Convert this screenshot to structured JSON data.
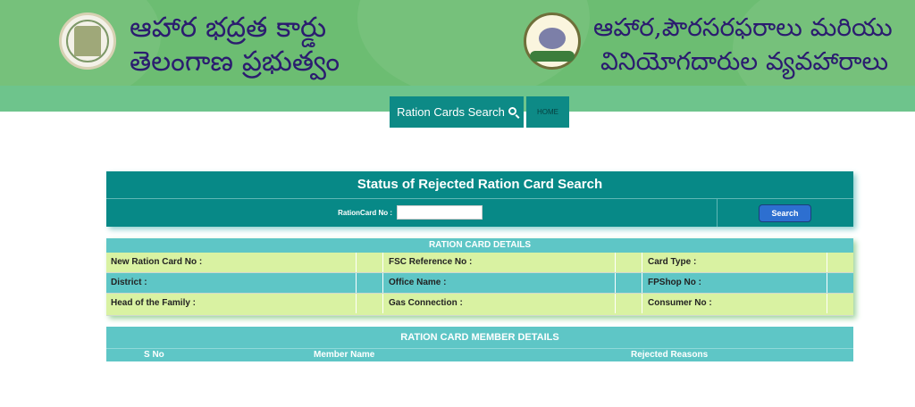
{
  "header": {
    "left_title_line1": "ఆహార భద్రత కార్డు",
    "left_title_line2": "తెలంగాణ ప్రభుత్వం",
    "right_title_line1": "ఆహార,పౌరసరఫరాలు మరియు",
    "right_title_line2": "వినియోగదారుల వ్యవహారాలు",
    "left_logo": "government-of-telangana-emblem",
    "right_logo": "department-seal"
  },
  "nav": {
    "search_label": "Ration Cards Search",
    "search_icon": "search-icon",
    "home_label": "HOME"
  },
  "search_panel": {
    "title": "Status of Rejected Ration Card Search",
    "rc_label": "RationCard No :",
    "rc_value": "",
    "button_label": "Search"
  },
  "details": {
    "heading": "RATION CARD DETAILS",
    "rows": [
      [
        "New Ration Card No :",
        "FSC Reference No :",
        "Card Type :"
      ],
      [
        "District :",
        "Office Name :",
        "FPShop No :"
      ],
      [
        "Head of the Family :",
        "Gas Connection :",
        "Consumer No :"
      ]
    ]
  },
  "members": {
    "heading": "RATION CARD MEMBER DETAILS",
    "columns": [
      "S No",
      "Member Name",
      "Rejected Reasons"
    ]
  },
  "colors": {
    "header_green": "#6cbd72",
    "teal": "#078987",
    "light_teal": "#5ec6c6",
    "light_green": "#d9f2a2",
    "title_blue": "#2b1c6f",
    "button_blue": "#2d6fd0"
  }
}
